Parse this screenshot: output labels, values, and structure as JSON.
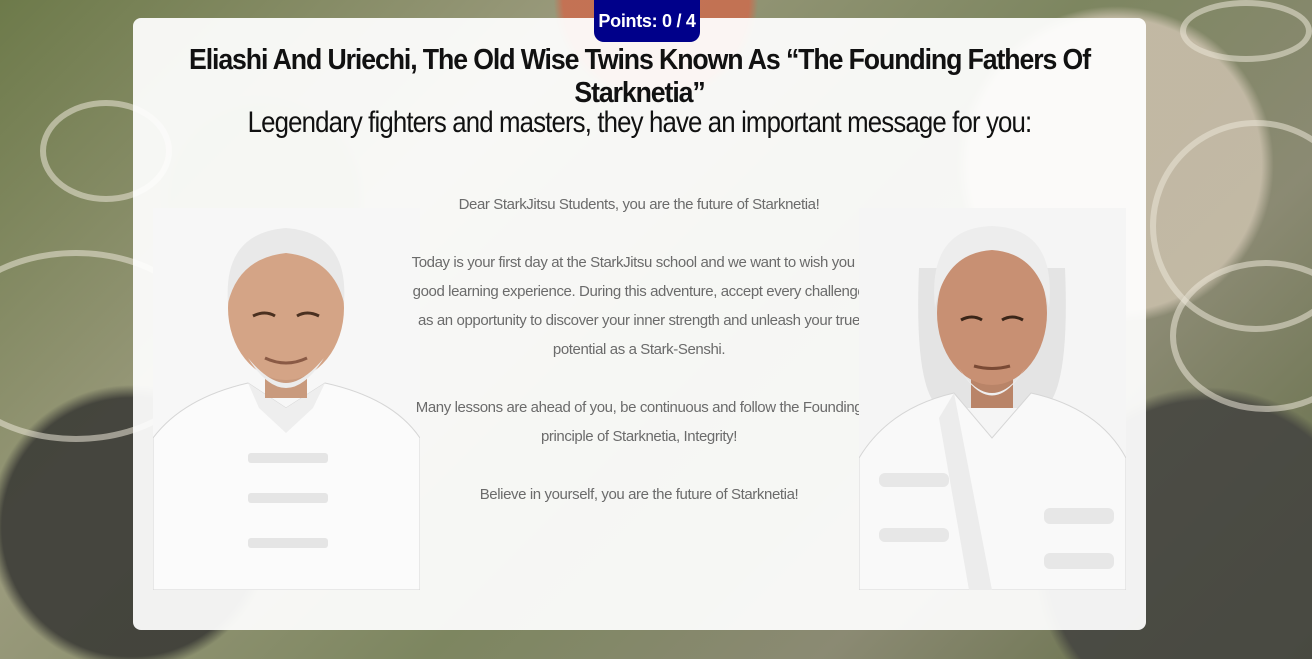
{
  "points": {
    "label": "Points:",
    "value": "0 / 4"
  },
  "title": "Eliashi And Uriechi, The Old Wise Twins Known As “The Founding Fathers Of Starknetia”",
  "subtitle": "Legendary fighters and masters, they have an important message for you:",
  "message": {
    "greeting": "Dear StarkJitsu Students, you are the future of Starknetia!",
    "paragraph1": "Today is your first day at the StarkJitsu school and we want to wish you a good learning experience. During this adventure, accept every challenge as an opportunity to discover your inner strength and unleash your true potential as a Stark-Senshi.",
    "paragraph2": "Many lessons are ahead of you, be continuous and follow the Founding principle of Starknetia, Integrity!",
    "closing": "Believe in yourself, you are the future of Starknetia!"
  },
  "portraits": {
    "left": "elder-eliashi",
    "right": "elder-uriechi"
  }
}
